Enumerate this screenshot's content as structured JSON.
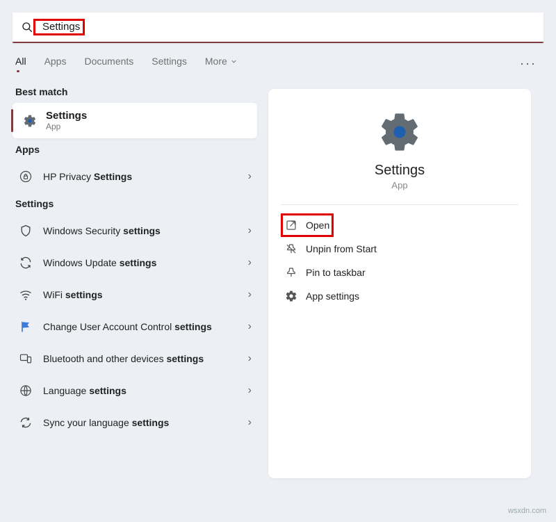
{
  "search": {
    "query": "Settings"
  },
  "tabs": {
    "all": "All",
    "apps": "Apps",
    "documents": "Documents",
    "settings": "Settings",
    "more": "More"
  },
  "left": {
    "best_match_label": "Best match",
    "best": {
      "title": "Settings",
      "subtitle": "App"
    },
    "apps_label": "Apps",
    "apps": [
      {
        "prefix": "HP Privacy ",
        "bold": "Settings"
      }
    ],
    "settings_label": "Settings",
    "settings": [
      {
        "prefix": "Windows Security ",
        "bold": "settings"
      },
      {
        "prefix": "Windows Update ",
        "bold": "settings"
      },
      {
        "prefix": "WiFi ",
        "bold": "settings"
      },
      {
        "prefix": "Change User Account Control ",
        "bold": "settings"
      },
      {
        "prefix": "Bluetooth and other devices ",
        "bold": "settings"
      },
      {
        "prefix": "Language ",
        "bold": "settings"
      },
      {
        "prefix": "Sync your language ",
        "bold": "settings"
      }
    ]
  },
  "detail": {
    "title": "Settings",
    "subtitle": "App",
    "actions": {
      "open": "Open",
      "unpin": "Unpin from Start",
      "pin_taskbar": "Pin to taskbar",
      "app_settings": "App settings"
    }
  },
  "watermark": "wsxdn.com"
}
